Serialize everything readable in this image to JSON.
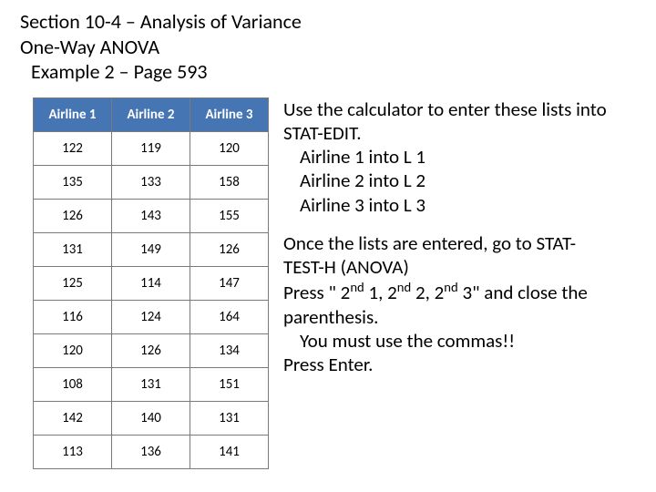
{
  "title": {
    "line1": "Section 10-4 – Analysis of Variance",
    "line2": "One-Way ANOVA",
    "line3": "Example 2 – Page 593"
  },
  "chart_data": {
    "type": "table",
    "headers": [
      "Airline 1",
      "Airline 2",
      "Airline 3"
    ],
    "rows": [
      [
        122,
        119,
        120
      ],
      [
        135,
        133,
        158
      ],
      [
        126,
        143,
        155
      ],
      [
        131,
        149,
        126
      ],
      [
        125,
        114,
        147
      ],
      [
        116,
        124,
        164
      ],
      [
        120,
        126,
        134
      ],
      [
        108,
        131,
        151
      ],
      [
        142,
        140,
        131
      ],
      [
        113,
        136,
        141
      ]
    ]
  },
  "instr": {
    "p1a": "Use the calculator to enter these lists into STAT-EDIT.",
    "p1b": "Airline 1 into L 1",
    "p1c": "Airline 2 into L 2",
    "p1d": "Airline 3 into L 3",
    "p2a": "Once the lists are entered, go to STAT-TEST-H (ANOVA)",
    "p2b_pre": "Press \" 2",
    "p2b_sup1": "nd",
    "p2b_mid1": " 1, 2",
    "p2b_sup2": "nd",
    "p2b_mid2": " 2, 2",
    "p2b_sup3": "nd",
    "p2b_post": " 3\" and close the parenthesis.",
    "p2c": "You must use the commas!!",
    "p2d": "Press Enter."
  }
}
